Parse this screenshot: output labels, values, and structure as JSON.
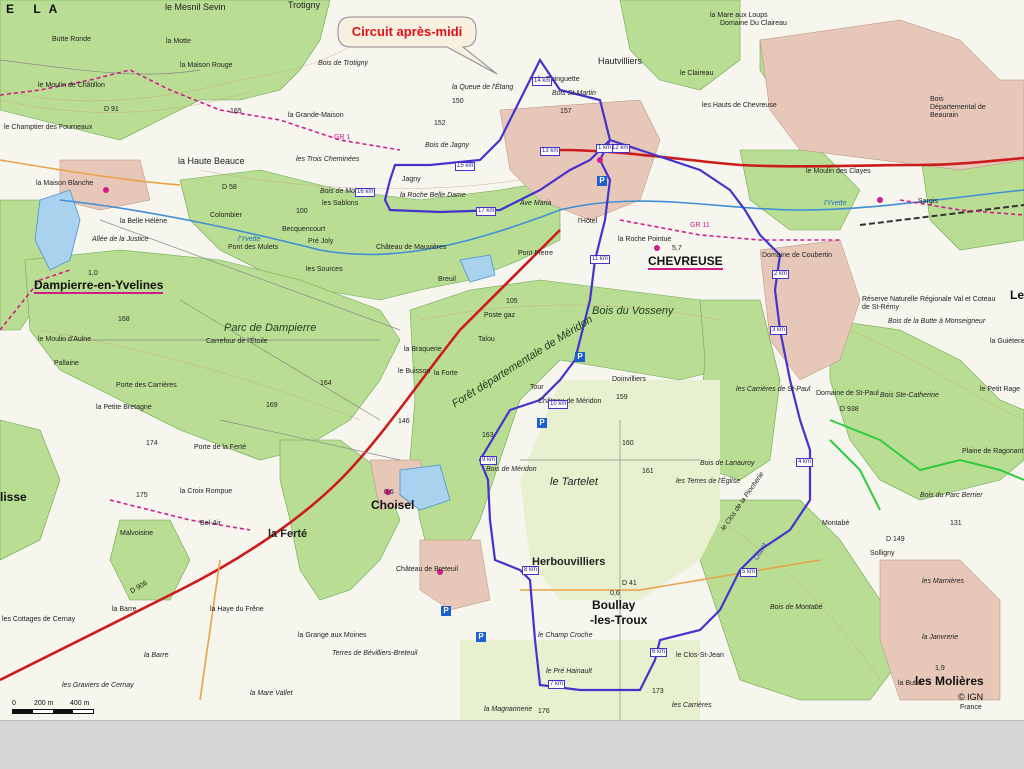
{
  "callout": {
    "title": "Circuit après-midi"
  },
  "towns": {
    "dampierre": "Dampierre-en-Yvelines",
    "chevreuse": "CHEVREUSE",
    "choisel": "Choisel",
    "boullay_line1": "Boullay",
    "boullay_line2": "-les-Troux",
    "molieres": "les Molières",
    "herbouvilliers": "Herbouvilliers",
    "la_ferte": "la Ferté",
    "lisse": "lisse",
    "le": "Le"
  },
  "places": {
    "mesnil_sevin": "le Mesnil Sevin",
    "trotigny": "Trotigny",
    "la_motte": "la Motte",
    "maison_rouge": "la Maison Rouge",
    "butte_ronde": "Butte Ronde",
    "moulin_chatillon": "le Moulin de Châtillon",
    "champtier": "le Champtier des Fourneaux",
    "maison_blanche": "la Maison Blanche",
    "haute_beauce": "la Haute Beauce",
    "grande_maison": "la Grande-Maison",
    "bois_trotigny": "Bois de Trotigny",
    "queue_etang": "la Queue de l'Étang",
    "guinguette": "la Guinguette",
    "bois_st_martin": "Bois St-Martin",
    "hautvilliers": "Hautvilliers",
    "mare_aux_loups": "la Mare aux Loups",
    "clairefeuilles": "le Claireau",
    "hauts_chevreuse": "les Hauts de Chevreuse",
    "bois_jagny": "Bois de Jagny",
    "jagny": "Jagny",
    "trois_chemineees": "les Trois Cheminées",
    "roche_belle_dame": "la Roche Belle Dame",
    "bois_mo": "Bois de Mo",
    "sablons": "les Sablons",
    "ave_maria": "Ave Maria",
    "hotel": "l'Hôtel",
    "roche_pointue": "la Roche Pointue",
    "becquencourt": "Becquencourt",
    "colombier": "Colombier",
    "pre_joly": "Pré Joly",
    "chateau_mauvieres": "Château de Mauvières",
    "sources": "les Sources",
    "breuil": "Breuil",
    "pont_pierre": "Pont Pierre",
    "belle_helene": "la Belle Hélène",
    "pont_mulets": "Pont des Mulets",
    "allee_justice": "Allée de la Justice",
    "parc_dampierre": "Parc de Dampierre",
    "carrefour_etoile": "Carrefour de l'Étoile",
    "bois_vosseny": "Bois du Vosseny",
    "foret_meridon": "Forêt départementale de Méridon",
    "braquerie": "la Braquerie",
    "buisson": "le Buisson",
    "la_forte": "la Forte",
    "talou": "Talou",
    "poste": "Poste gaz",
    "moulin_aulne": "le Moulin d'Aulne",
    "pallaine": "Pallaine",
    "porte_carrieres": "Porte des Carrières",
    "petite_bretagne": "la Petite Bretagne",
    "porte_ferte": "Porte de la Ferté",
    "chateau_meridon": "Château de Méridon",
    "tour": "Tour",
    "doinvilliers": "Doinvilliers",
    "le_tartelet": "le Tartelet",
    "terres_eglise": "les Terres de l'Église",
    "bois_meridon": "Bois de Méridon",
    "croix_rompue": "la Croix Rompue",
    "malvoisine": "Malvoisine",
    "bel_air": "Bel-Air",
    "haye_frene": "la Haye du Frêne",
    "chateau_breteuil": "Château de Breteuil",
    "grange_moines": "la Grange aux Moines",
    "terres_bevilliers": "Terres de Bévilliers-Breteuil",
    "la_barre": "la Barre",
    "cottages_cernay": "les Cottages de Cernay",
    "graviers_cernay": "les Graviers de Cernay",
    "mare_vallet": "la Mare Vallet",
    "champ_croche": "le Champ Croche",
    "pre_hainault": "le Pré Hainault",
    "magnannerie": "la Magnannerie",
    "les_carrieres": "les Carrières",
    "clos_st_jean": "le Clos-St-Jean",
    "clos_piocherie": "le Clos de la Piocherie",
    "bois_montabe": "Bois de Montabé",
    "montabe": "Montabé",
    "solligny": "Solligny",
    "marnieres": "les Marnières",
    "janvrerie": "la Janvrerie",
    "bois_lanauroy": "Bois de Lanauroy",
    "carrieres_st_paul": "les Carrières de St-Paul",
    "domaine_st_paul": "Domaine de St-Paul",
    "domaine_coubertin": "Domaine de Coubertin",
    "reserve_val": "Réserve Naturelle Régionale Val et Coteau de St-Rémy",
    "bois_butte_monseigneur": "Bois de la Butte à Monseigneur",
    "bois_ste_catherine": "Bois Ste-Catherine",
    "petit_rage": "le Petit Rage",
    "plaine_ragonant": "Plaine de Ragonant",
    "bois_parc_berrier": "Bois du Parc Berrier",
    "bois_beaurain": "Bois Départemental de Beaurain",
    "moulin_claye": "le Moulin des Clayes",
    "sargis": "Sargis",
    "la_butte": "la Butte",
    "vaumurier": "la Guiéterie",
    "mare_vallee": "Domaine Du Claireau"
  },
  "rivers": {
    "yvette_west": "l'Yvette",
    "yvette_east": "l'Yvette"
  },
  "roads": {
    "d91": "D 91",
    "d58": "D 58",
    "d906": "D 906",
    "d41": "D 41",
    "d938": "D 938",
    "d149": "D 149"
  },
  "trail_labels": {
    "gr1": "GR 1",
    "gr11": "GR 11",
    "ouest": "Ouest"
  },
  "km_markers": [
    "14 km",
    "15 km",
    "16 km",
    "17 km",
    "12 km",
    "11 km",
    "13 km",
    "10 km",
    "9 km",
    "8 km",
    "7 km",
    "6 km",
    "5 km",
    "4 km",
    "3 km",
    "2 km",
    "1 km"
  ],
  "altitudes": [
    "165",
    "152",
    "174",
    "150",
    "100",
    "168",
    "160",
    "161",
    "175",
    "146",
    "163",
    "157",
    "176",
    "164",
    "105",
    "159",
    "173",
    "169",
    "131"
  ],
  "population": {
    "dampierre": "1,0",
    "chevreuse": "5,7",
    "choisel": "0,6",
    "boullay": "0,6",
    "molieres": "1,9"
  },
  "scale": {
    "zero": "0",
    "mid": "200 m",
    "end": "400 m"
  },
  "copyright": "© IGN",
  "edge": {
    "la": "E LA",
    "france": "France"
  },
  "colors": {
    "route_blue": "#4433cc",
    "forest_green": "#b7dc8e",
    "gr_magenta": "#d21c8c",
    "main_road": "#cc1b1b",
    "water": "#8fc6ea",
    "callout_text": "#e0101a"
  }
}
